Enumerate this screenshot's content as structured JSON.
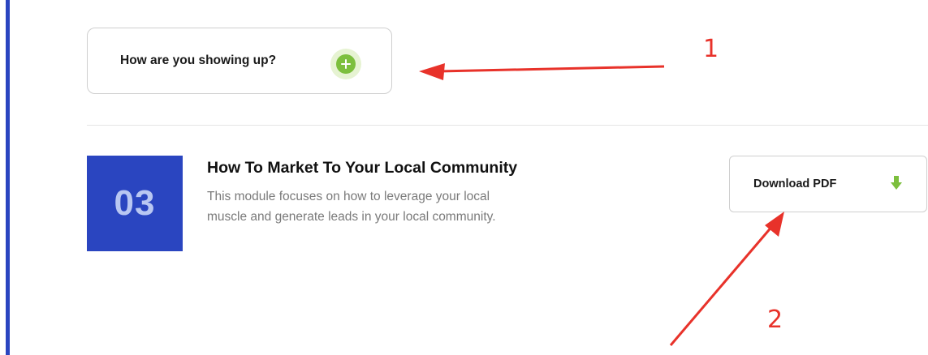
{
  "accordion": {
    "label": "How are you showing up?",
    "expand_icon": "plus-circle-icon",
    "accent_color": "#7cbf3d"
  },
  "module": {
    "number": "03",
    "title": "How To Market To Your Local Community",
    "description": "This module focuses on how to leverage your local muscle and generate leads in your local community.",
    "badge_color": "#2a45c0"
  },
  "download": {
    "label": "Download PDF",
    "icon": "download-arrow-icon"
  },
  "annotations": {
    "marker_1": "1",
    "marker_2": "2",
    "color": "#e8322a"
  }
}
